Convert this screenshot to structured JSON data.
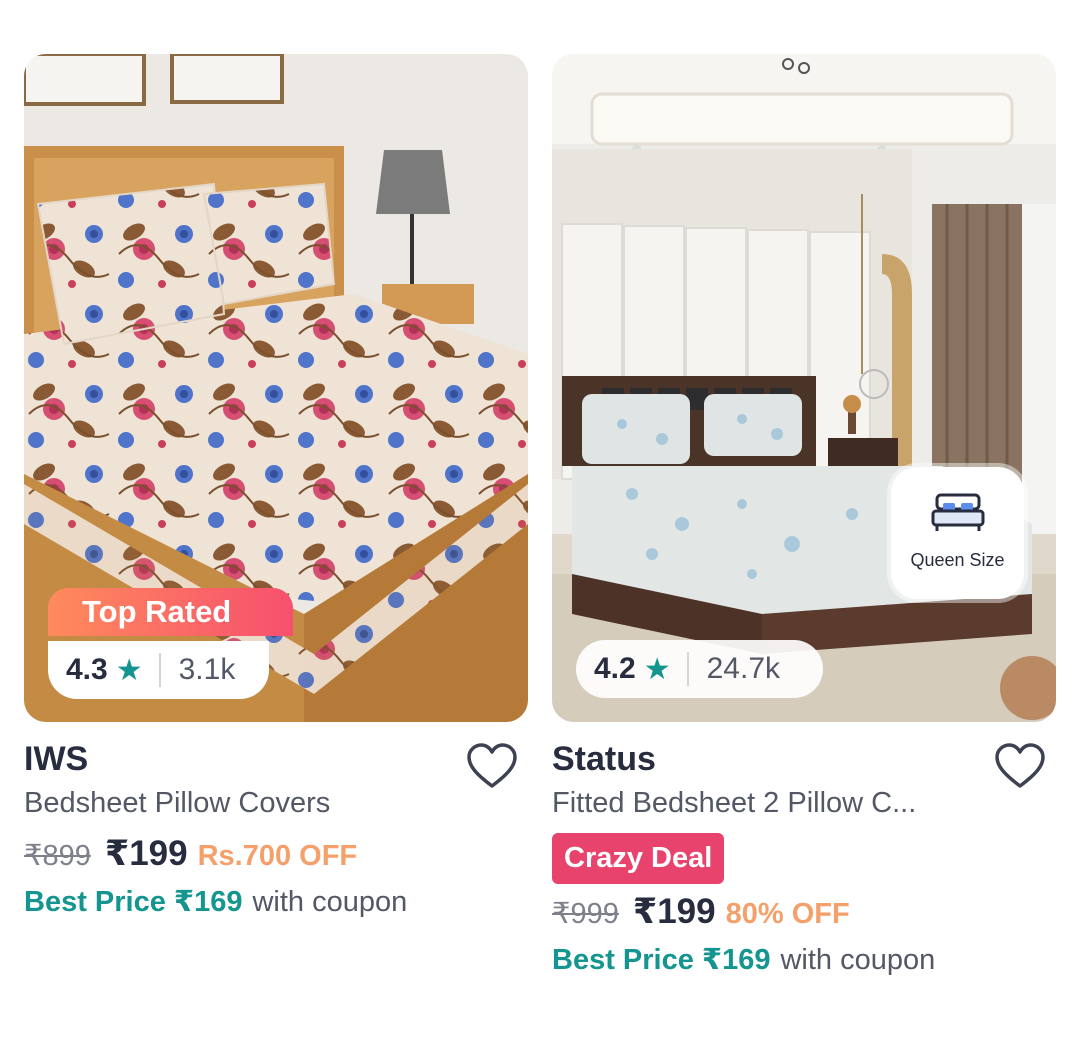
{
  "products": [
    {
      "brand": "IWS",
      "title": "Bedsheet Pillow Covers",
      "badge": "Top Rated",
      "rating": "4.3",
      "rating_count": "3.1k",
      "mrp": "₹899",
      "price": "₹199",
      "discount": "Rs.700 OFF",
      "best_price": "Best Price ₹169",
      "coupon_text": "with coupon",
      "wishlisted": false
    },
    {
      "brand": "Status",
      "title": "Fitted Bedsheet 2 Pillow C...",
      "size_tag": "Queen Size",
      "deal_badge": "Crazy Deal",
      "rating": "4.2",
      "rating_count": "24.7k",
      "mrp": "₹999",
      "price": "₹199",
      "discount": "80% OFF",
      "best_price": "Best Price ₹169",
      "coupon_text": "with coupon",
      "wishlisted": false
    }
  ],
  "icons": {
    "star": "star-icon",
    "heart": "heart-icon",
    "bed": "bed-icon"
  },
  "colors": {
    "teal": "#14958f",
    "offer_orange": "#f5a06a",
    "deal_pink": "#e8436d",
    "text_dark": "#282c3f",
    "text_grey": "#535766"
  }
}
